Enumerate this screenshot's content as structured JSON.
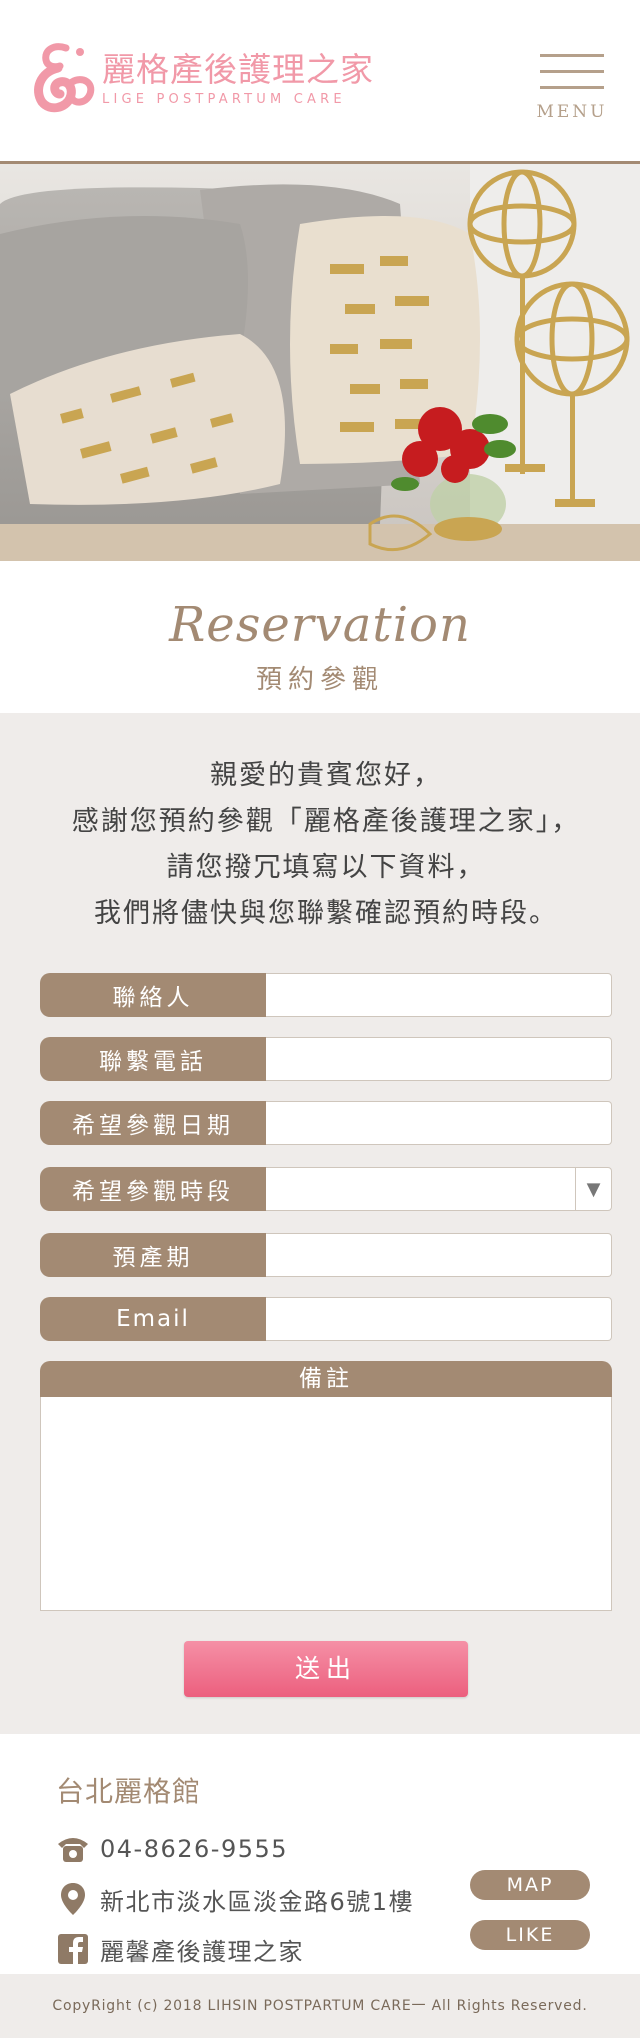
{
  "header": {
    "logo_cn": "麗格產後護理之家",
    "logo_en": "LIGE POSTPARTUM CARE",
    "menu_label": "MENU"
  },
  "section": {
    "title_script": "Reservation",
    "title_cn": "預約參觀"
  },
  "intro": {
    "lines": [
      "親愛的貴賓您好，",
      "感謝您預約參觀「麗格產後護理之家」，",
      "請您撥冗填寫以下資料，",
      "我們將儘快與您聯繫確認預約時段。"
    ]
  },
  "form": {
    "contact_label": "聯絡人",
    "phone_label": "聯繫電話",
    "date_label": "希望參觀日期",
    "time_label": "希望參觀時段",
    "time_selected": "",
    "due_label": "預產期",
    "email_label": "Email",
    "memo_label": "備註",
    "submit_label": "送出"
  },
  "footer": {
    "branch": "台北麗格館",
    "phone": "04-8626-9555",
    "address": "新北市淡水區淡金路6號1樓",
    "facebook": "麗馨產後護理之家",
    "map_label": "MAP",
    "like_label": "LIKE",
    "copyright": "CopyRight (c) 2018   LIHSIN POSTPARTUM CARE一  All Rights Reserved."
  },
  "icons": {
    "phone": "phone-icon",
    "location": "map-pin-icon",
    "facebook": "facebook-icon",
    "menu": "hamburger-icon",
    "dropdown": "triangle-down-icon"
  },
  "colors": {
    "brand_brown": "#a38a73",
    "brand_pink": "#f199a8",
    "submit_pink": "#ec5f7e",
    "form_bg": "#efecea"
  }
}
